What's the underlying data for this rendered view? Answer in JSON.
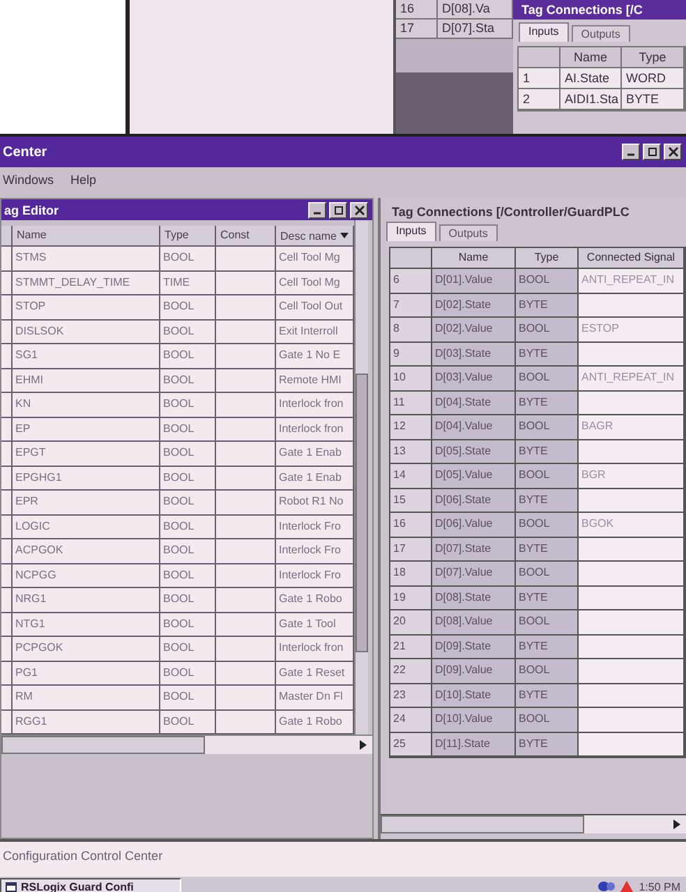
{
  "background_window": {
    "rows": [
      {
        "number": "16",
        "name": "D[08].Va"
      },
      {
        "number": "17",
        "name": "D[07].Sta"
      }
    ],
    "tag_connections": {
      "title": "Tag Connections [/C",
      "tabs": [
        {
          "label": "Inputs",
          "selected": true
        },
        {
          "label": "Outputs",
          "selected": false
        }
      ],
      "columns": [
        "Name",
        "Type"
      ],
      "rows": [
        {
          "number": "1",
          "name": "AI.State",
          "type": "WORD"
        },
        {
          "number": "2",
          "name": "AIDI1.Sta",
          "type": "BYTE"
        }
      ]
    }
  },
  "window": {
    "title": "Center",
    "menu": [
      "Windows",
      "Help"
    ]
  },
  "tag_editor": {
    "title": "ag Editor",
    "columns": [
      "Name",
      "Type",
      "Const",
      "Desc name"
    ],
    "rows": [
      {
        "name": "STMS",
        "type": "BOOL",
        "description": "Cell Tool Mg"
      },
      {
        "name": "STMMT_DELAY_TIME",
        "type": "TIME",
        "description": "Cell Tool Mg"
      },
      {
        "name": "STOP",
        "type": "BOOL",
        "description": "Cell Tool Out"
      },
      {
        "name": "DISLSOK",
        "type": "BOOL",
        "description": "Exit Interroll"
      },
      {
        "name": "SG1",
        "type": "BOOL",
        "description": "Gate 1 No E"
      },
      {
        "name": "EHMI",
        "type": "BOOL",
        "description": "Remote HMI"
      },
      {
        "name": "KN",
        "type": "BOOL",
        "description": "Interlock fron"
      },
      {
        "name": "EP",
        "type": "BOOL",
        "description": "Interlock fron"
      },
      {
        "name": "EPGT",
        "type": "BOOL",
        "description": "Gate 1 Enab"
      },
      {
        "name": "EPGHG1",
        "type": "BOOL",
        "description": "Gate 1 Enab"
      },
      {
        "name": "EPR",
        "type": "BOOL",
        "description": "Robot R1 No"
      },
      {
        "name": "LOGIC",
        "type": "BOOL",
        "description": "Interlock Fro"
      },
      {
        "name": "ACPGOK",
        "type": "BOOL",
        "description": "Interlock Fro"
      },
      {
        "name": "NCPGG",
        "type": "BOOL",
        "description": "Interlock Fro"
      },
      {
        "name": "NRG1",
        "type": "BOOL",
        "description": "Gate 1 Robo"
      },
      {
        "name": "NTG1",
        "type": "BOOL",
        "description": "Gate 1 Tool"
      },
      {
        "name": "PCPGOK",
        "type": "BOOL",
        "description": "Interlock fron"
      },
      {
        "name": "PG1",
        "type": "BOOL",
        "description": "Gate 1 Reset"
      },
      {
        "name": "RM",
        "type": "BOOL",
        "description": "Master Dn Fl"
      },
      {
        "name": "RGG1",
        "type": "BOOL",
        "description": "Gate 1 Robo"
      }
    ]
  },
  "tag_connections": {
    "title": "Tag Connections [/Controller/GuardPLC",
    "tabs": [
      {
        "label": "Inputs",
        "selected": true
      },
      {
        "label": "Outputs",
        "selected": false
      }
    ],
    "columns": [
      "Name",
      "Type",
      "Connected Signal"
    ],
    "rows": [
      {
        "number": "6",
        "name": "D[01].Value",
        "type": "BOOL",
        "signal": "ANTI_REPEAT_IN"
      },
      {
        "number": "7",
        "name": "D[02].State",
        "type": "BYTE"
      },
      {
        "number": "8",
        "name": "D[02].Value",
        "type": "BOOL",
        "signal": "ESTOP"
      },
      {
        "number": "9",
        "name": "D[03].State",
        "type": "BYTE"
      },
      {
        "number": "10",
        "name": "D[03].Value",
        "type": "BOOL",
        "signal": "ANTI_REPEAT_IN"
      },
      {
        "number": "11",
        "name": "D[04].State",
        "type": "BYTE"
      },
      {
        "number": "12",
        "name": "D[04].Value",
        "type": "BOOL",
        "signal": "BAGR"
      },
      {
        "number": "13",
        "name": "D[05].State",
        "type": "BYTE"
      },
      {
        "number": "14",
        "name": "D[05].Value",
        "type": "BOOL",
        "signal": "BGR"
      },
      {
        "number": "15",
        "name": "D[06].State",
        "type": "BYTE"
      },
      {
        "number": "16",
        "name": "D[06].Value",
        "type": "BOOL",
        "signal": "BGOK"
      },
      {
        "number": "17",
        "name": "D[07].State",
        "type": "BYTE"
      },
      {
        "number": "18",
        "name": "D[07].Value",
        "type": "BOOL"
      },
      {
        "number": "19",
        "name": "D[08].State",
        "type": "BYTE"
      },
      {
        "number": "20",
        "name": "D[08].Value",
        "type": "BOOL"
      },
      {
        "number": "21",
        "name": "D[09].State",
        "type": "BYTE"
      },
      {
        "number": "22",
        "name": "D[09].Value",
        "type": "BOOL"
      },
      {
        "number": "23",
        "name": "D[10].State",
        "type": "BYTE"
      },
      {
        "number": "24",
        "name": "D[10].Value",
        "type": "BOOL"
      },
      {
        "number": "25",
        "name": "D[11].State",
        "type": "BYTE"
      }
    ]
  },
  "status_bar": "Configuration Control Center",
  "taskbar": {
    "items": [
      {
        "label": "RSLogix Guard Confi",
        "selected": true
      }
    ],
    "clock": "1:50 PM"
  }
}
